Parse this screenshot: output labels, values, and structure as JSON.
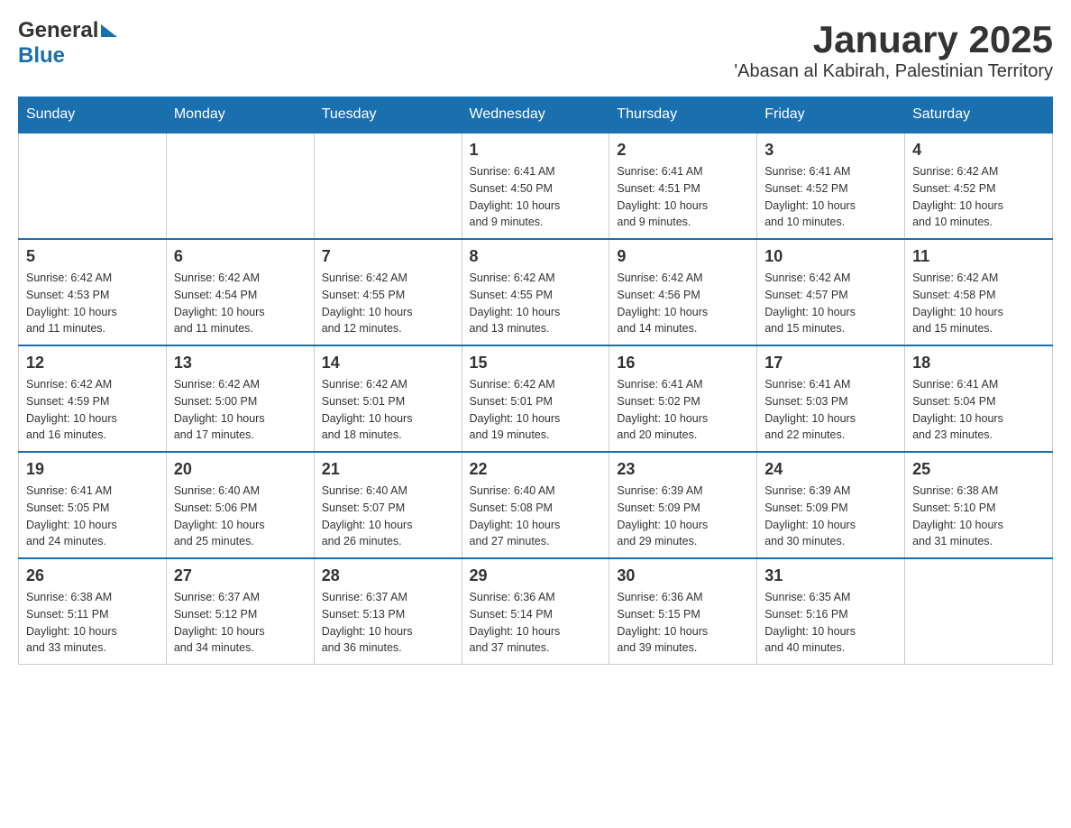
{
  "header": {
    "logo": {
      "general": "General",
      "arrow": "",
      "blue": "Blue"
    },
    "title": "January 2025",
    "subtitle": "'Abasan al Kabirah, Palestinian Territory"
  },
  "calendar": {
    "days_of_week": [
      "Sunday",
      "Monday",
      "Tuesday",
      "Wednesday",
      "Thursday",
      "Friday",
      "Saturday"
    ],
    "weeks": [
      [
        {
          "day": "",
          "info": ""
        },
        {
          "day": "",
          "info": ""
        },
        {
          "day": "",
          "info": ""
        },
        {
          "day": "1",
          "info": "Sunrise: 6:41 AM\nSunset: 4:50 PM\nDaylight: 10 hours\nand 9 minutes."
        },
        {
          "day": "2",
          "info": "Sunrise: 6:41 AM\nSunset: 4:51 PM\nDaylight: 10 hours\nand 9 minutes."
        },
        {
          "day": "3",
          "info": "Sunrise: 6:41 AM\nSunset: 4:52 PM\nDaylight: 10 hours\nand 10 minutes."
        },
        {
          "day": "4",
          "info": "Sunrise: 6:42 AM\nSunset: 4:52 PM\nDaylight: 10 hours\nand 10 minutes."
        }
      ],
      [
        {
          "day": "5",
          "info": "Sunrise: 6:42 AM\nSunset: 4:53 PM\nDaylight: 10 hours\nand 11 minutes."
        },
        {
          "day": "6",
          "info": "Sunrise: 6:42 AM\nSunset: 4:54 PM\nDaylight: 10 hours\nand 11 minutes."
        },
        {
          "day": "7",
          "info": "Sunrise: 6:42 AM\nSunset: 4:55 PM\nDaylight: 10 hours\nand 12 minutes."
        },
        {
          "day": "8",
          "info": "Sunrise: 6:42 AM\nSunset: 4:55 PM\nDaylight: 10 hours\nand 13 minutes."
        },
        {
          "day": "9",
          "info": "Sunrise: 6:42 AM\nSunset: 4:56 PM\nDaylight: 10 hours\nand 14 minutes."
        },
        {
          "day": "10",
          "info": "Sunrise: 6:42 AM\nSunset: 4:57 PM\nDaylight: 10 hours\nand 15 minutes."
        },
        {
          "day": "11",
          "info": "Sunrise: 6:42 AM\nSunset: 4:58 PM\nDaylight: 10 hours\nand 15 minutes."
        }
      ],
      [
        {
          "day": "12",
          "info": "Sunrise: 6:42 AM\nSunset: 4:59 PM\nDaylight: 10 hours\nand 16 minutes."
        },
        {
          "day": "13",
          "info": "Sunrise: 6:42 AM\nSunset: 5:00 PM\nDaylight: 10 hours\nand 17 minutes."
        },
        {
          "day": "14",
          "info": "Sunrise: 6:42 AM\nSunset: 5:01 PM\nDaylight: 10 hours\nand 18 minutes."
        },
        {
          "day": "15",
          "info": "Sunrise: 6:42 AM\nSunset: 5:01 PM\nDaylight: 10 hours\nand 19 minutes."
        },
        {
          "day": "16",
          "info": "Sunrise: 6:41 AM\nSunset: 5:02 PM\nDaylight: 10 hours\nand 20 minutes."
        },
        {
          "day": "17",
          "info": "Sunrise: 6:41 AM\nSunset: 5:03 PM\nDaylight: 10 hours\nand 22 minutes."
        },
        {
          "day": "18",
          "info": "Sunrise: 6:41 AM\nSunset: 5:04 PM\nDaylight: 10 hours\nand 23 minutes."
        }
      ],
      [
        {
          "day": "19",
          "info": "Sunrise: 6:41 AM\nSunset: 5:05 PM\nDaylight: 10 hours\nand 24 minutes."
        },
        {
          "day": "20",
          "info": "Sunrise: 6:40 AM\nSunset: 5:06 PM\nDaylight: 10 hours\nand 25 minutes."
        },
        {
          "day": "21",
          "info": "Sunrise: 6:40 AM\nSunset: 5:07 PM\nDaylight: 10 hours\nand 26 minutes."
        },
        {
          "day": "22",
          "info": "Sunrise: 6:40 AM\nSunset: 5:08 PM\nDaylight: 10 hours\nand 27 minutes."
        },
        {
          "day": "23",
          "info": "Sunrise: 6:39 AM\nSunset: 5:09 PM\nDaylight: 10 hours\nand 29 minutes."
        },
        {
          "day": "24",
          "info": "Sunrise: 6:39 AM\nSunset: 5:09 PM\nDaylight: 10 hours\nand 30 minutes."
        },
        {
          "day": "25",
          "info": "Sunrise: 6:38 AM\nSunset: 5:10 PM\nDaylight: 10 hours\nand 31 minutes."
        }
      ],
      [
        {
          "day": "26",
          "info": "Sunrise: 6:38 AM\nSunset: 5:11 PM\nDaylight: 10 hours\nand 33 minutes."
        },
        {
          "day": "27",
          "info": "Sunrise: 6:37 AM\nSunset: 5:12 PM\nDaylight: 10 hours\nand 34 minutes."
        },
        {
          "day": "28",
          "info": "Sunrise: 6:37 AM\nSunset: 5:13 PM\nDaylight: 10 hours\nand 36 minutes."
        },
        {
          "day": "29",
          "info": "Sunrise: 6:36 AM\nSunset: 5:14 PM\nDaylight: 10 hours\nand 37 minutes."
        },
        {
          "day": "30",
          "info": "Sunrise: 6:36 AM\nSunset: 5:15 PM\nDaylight: 10 hours\nand 39 minutes."
        },
        {
          "day": "31",
          "info": "Sunrise: 6:35 AM\nSunset: 5:16 PM\nDaylight: 10 hours\nand 40 minutes."
        },
        {
          "day": "",
          "info": ""
        }
      ]
    ]
  }
}
